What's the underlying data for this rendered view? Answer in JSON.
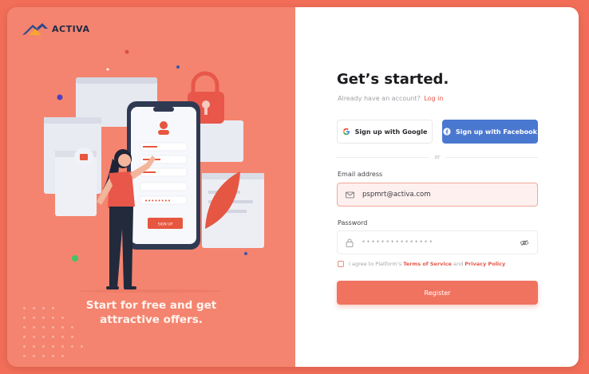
{
  "brand": {
    "name": "ACTIVA"
  },
  "hero": {
    "tagline_line1": "Start for free and get",
    "tagline_line2": "attractive offers.",
    "phone_button_label": "SIGN UP",
    "phone_password_mask": "••••••••"
  },
  "form": {
    "title": "Get’s started.",
    "subtitle_prefix": "Already have an account?",
    "login_link": "Log in",
    "google_button": "Sign up with Google",
    "facebook_button": "Sign up with Facebook",
    "divider_text": "or",
    "email_label": "Email address",
    "email_value": "pspmrt@activa.com",
    "password_label": "Password",
    "password_value": "•••••••••••••••",
    "terms_prefix": "I agree to Platform’s",
    "terms_link": "Terms of Service",
    "terms_and": "and",
    "privacy_link": "Privacy Policy",
    "register_button": "Register"
  },
  "colors": {
    "background": "#f26e58",
    "left_panel": "#f4846f",
    "accent": "#e4574a",
    "facebook": "#4a78d0",
    "register": "#f07360"
  },
  "icons": {
    "brand": "house-logo-icon",
    "google": "google-icon",
    "facebook": "facebook-icon",
    "email": "mail-icon",
    "password": "lock-icon",
    "visibility": "eye-off-icon"
  }
}
